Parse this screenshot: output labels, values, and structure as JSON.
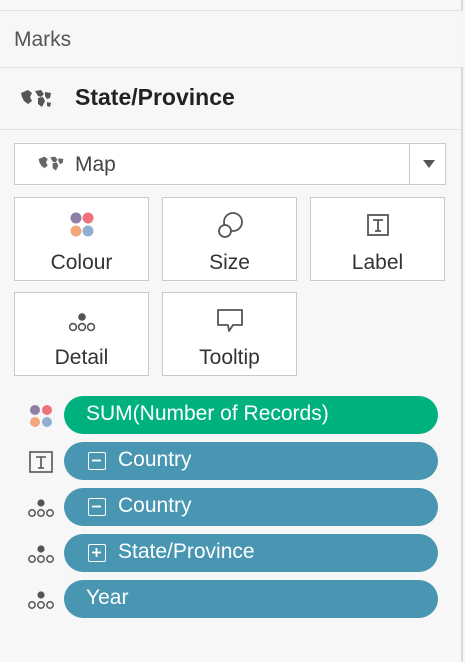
{
  "marks": {
    "title": "Marks"
  },
  "layer": {
    "title": "State/Province",
    "icon": "map-icon"
  },
  "mark_type": {
    "selected": "Map",
    "icon": "map-icon"
  },
  "cards": [
    {
      "label": "Colour",
      "icon": "colour-dots-icon"
    },
    {
      "label": "Size",
      "icon": "size-circles-icon"
    },
    {
      "label": "Label",
      "icon": "text-label-icon"
    },
    {
      "label": "Detail",
      "icon": "detail-dots-icon"
    },
    {
      "label": "Tooltip",
      "icon": "tooltip-bubble-icon"
    }
  ],
  "pills": [
    {
      "label": "SUM(Number of Records)",
      "color": "#00b180",
      "role": "colour",
      "expander": ""
    },
    {
      "label": "Country",
      "color": "#4996b2",
      "role": "label",
      "expander": "minus"
    },
    {
      "label": "Country",
      "color": "#4996b2",
      "role": "detail",
      "expander": "minus"
    },
    {
      "label": "State/Province",
      "color": "#4996b2",
      "role": "detail",
      "expander": "plus"
    },
    {
      "label": "Year",
      "color": "#4996b2",
      "role": "detail",
      "expander": ""
    }
  ],
  "colors": {
    "dot_purple": "#8e7ea8",
    "dot_red": "#f0707c",
    "dot_orange": "#f2a77b",
    "dot_blue": "#8fb0d4"
  }
}
